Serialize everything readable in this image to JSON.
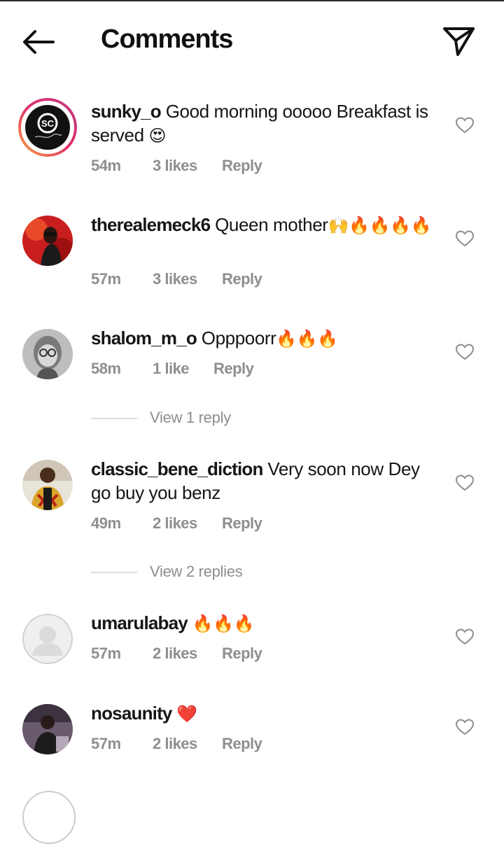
{
  "header": {
    "title": "Comments",
    "back_icon": "arrow-left-icon",
    "share_icon": "paper-plane-icon"
  },
  "comments": [
    {
      "username": "sunky_o",
      "text": "Good morning ooooo Breakfast is served",
      "emoji": "😍",
      "time": "54m",
      "likes": "3 likes",
      "reply": "Reply"
    },
    {
      "username": "therealemeck6",
      "text": "Queen mother",
      "emoji": "🙌🔥🔥🔥🔥",
      "time": "57m",
      "likes": "3 likes",
      "reply": "Reply"
    },
    {
      "username": "shalom_m_o",
      "text": "Opppoorr",
      "emoji": "🔥🔥🔥",
      "time": "58m",
      "likes": "1 like",
      "reply": "Reply",
      "view_replies": "View 1 reply"
    },
    {
      "username": "classic_bene_diction",
      "text": "Very soon now Dey go buy you benz",
      "emoji": "",
      "time": "49m",
      "likes": "2 likes",
      "reply": "Reply",
      "view_replies": "View 2 replies"
    },
    {
      "username": "umarulabay",
      "text": "",
      "emoji": "🔥🔥🔥",
      "time": "57m",
      "likes": "2 likes",
      "reply": "Reply"
    },
    {
      "username": "nosaunity",
      "text": "",
      "emoji": "❤️",
      "time": "57m",
      "likes": "2 likes",
      "reply": "Reply"
    }
  ],
  "colors": {
    "meta": "#8e8e8e",
    "fire": "#ff6a00",
    "heart": "#e0201c"
  }
}
